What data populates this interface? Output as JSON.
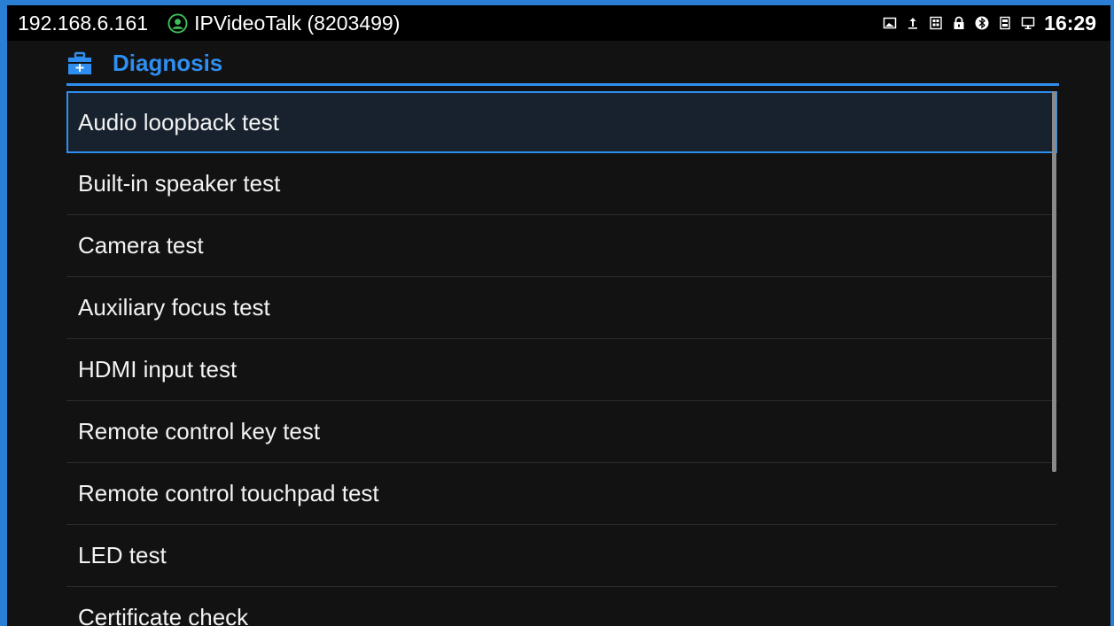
{
  "status_bar": {
    "ip_address": "192.168.6.161",
    "account": "IPVideoTalk (8203499)",
    "time": "16:29",
    "icons": [
      "image-icon",
      "upload-icon",
      "sim-card-icon",
      "lock-icon",
      "bluetooth-icon",
      "memory-card-icon",
      "monitor-icon"
    ]
  },
  "header": {
    "title": "Diagnosis",
    "icon": "toolbox-icon"
  },
  "list": {
    "items": [
      {
        "label": "Audio loopback test",
        "selected": true
      },
      {
        "label": "Built-in speaker test",
        "selected": false
      },
      {
        "label": "Camera test",
        "selected": false
      },
      {
        "label": "Auxiliary focus test",
        "selected": false
      },
      {
        "label": "HDMI input test",
        "selected": false
      },
      {
        "label": "Remote control key test",
        "selected": false
      },
      {
        "label": "Remote control touchpad test",
        "selected": false
      },
      {
        "label": "LED test",
        "selected": false
      },
      {
        "label": "Certificate check",
        "selected": false
      }
    ]
  },
  "colors": {
    "accent": "#2f8ff0",
    "background": "#121212",
    "account_status": "#3fc05a"
  }
}
